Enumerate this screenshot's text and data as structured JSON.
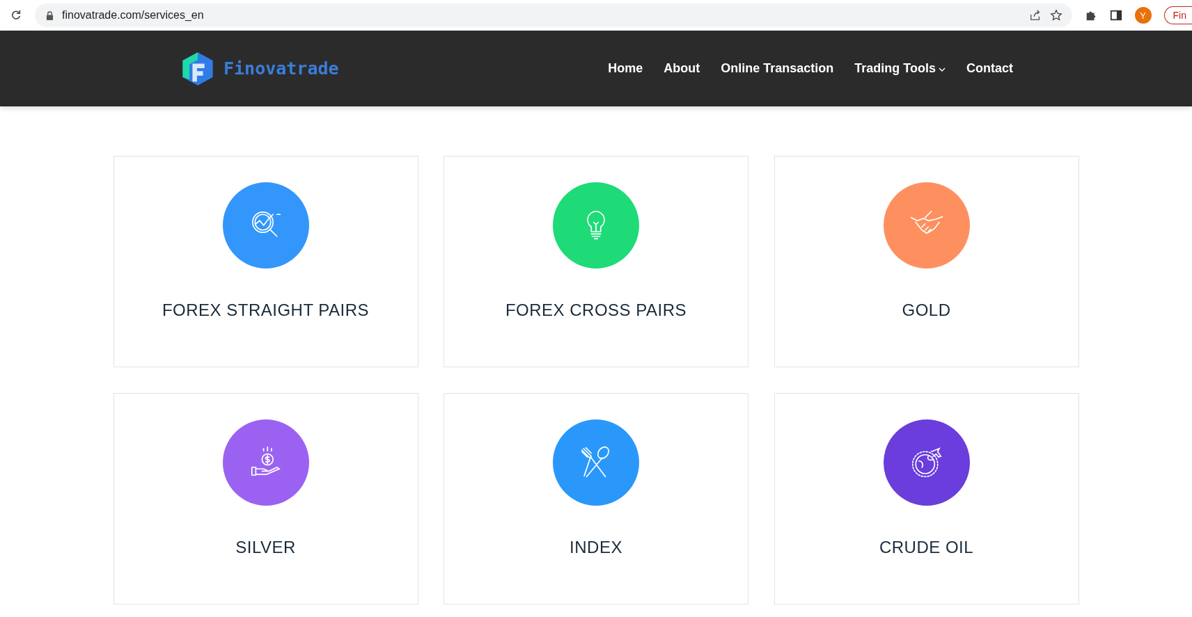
{
  "browser": {
    "url": "finovatrade.com/services_en",
    "avatar": "Y",
    "profile_button": "Fin"
  },
  "header": {
    "brand": "Finovatrade",
    "nav": [
      {
        "label": "Home",
        "has_dropdown": false
      },
      {
        "label": "About",
        "has_dropdown": false
      },
      {
        "label": "Online Transaction",
        "has_dropdown": false
      },
      {
        "label": "Trading Tools",
        "has_dropdown": true
      },
      {
        "label": "Contact",
        "has_dropdown": false
      }
    ]
  },
  "services": [
    {
      "title": "FOREX STRAIGHT PAIRS",
      "kind": "chart-search",
      "color": "#3396fb"
    },
    {
      "title": "FOREX CROSS PAIRS",
      "kind": "bulb",
      "color": "#1edb78"
    },
    {
      "title": "GOLD",
      "kind": "handshake",
      "color": "#fe9060"
    },
    {
      "title": "SILVER",
      "kind": "coin-hand",
      "color": "#9b62f2"
    },
    {
      "title": "INDEX",
      "kind": "fork-spoon",
      "color": "#2a98fb"
    },
    {
      "title": "CRUDE OIL",
      "kind": "globe-plane",
      "color": "#6a3ddc"
    }
  ]
}
